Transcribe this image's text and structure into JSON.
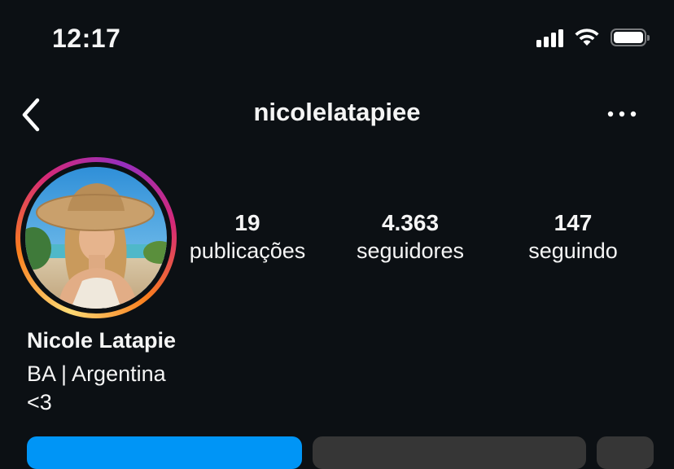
{
  "status_bar": {
    "time": "12:17",
    "icons": [
      "signal-icon",
      "wifi-icon",
      "battery-icon"
    ]
  },
  "header": {
    "username": "nicolelatapiee",
    "back_icon": "chevron-left-icon",
    "more_icon": "more-horizontal-icon"
  },
  "profile": {
    "avatar": "profile-photo",
    "stats": [
      {
        "count": "19",
        "label": "publicações"
      },
      {
        "count": "4.363",
        "label": "seguidores"
      },
      {
        "count": "147",
        "label": "seguindo"
      }
    ],
    "display_name": "Nicole Latapie",
    "bio": [
      "BA | Argentina",
      "<3"
    ]
  },
  "colors": {
    "background": "#0c1014",
    "text": "#f5f5f5",
    "primary_button": "#0095f6",
    "secondary_button": "#363636"
  }
}
